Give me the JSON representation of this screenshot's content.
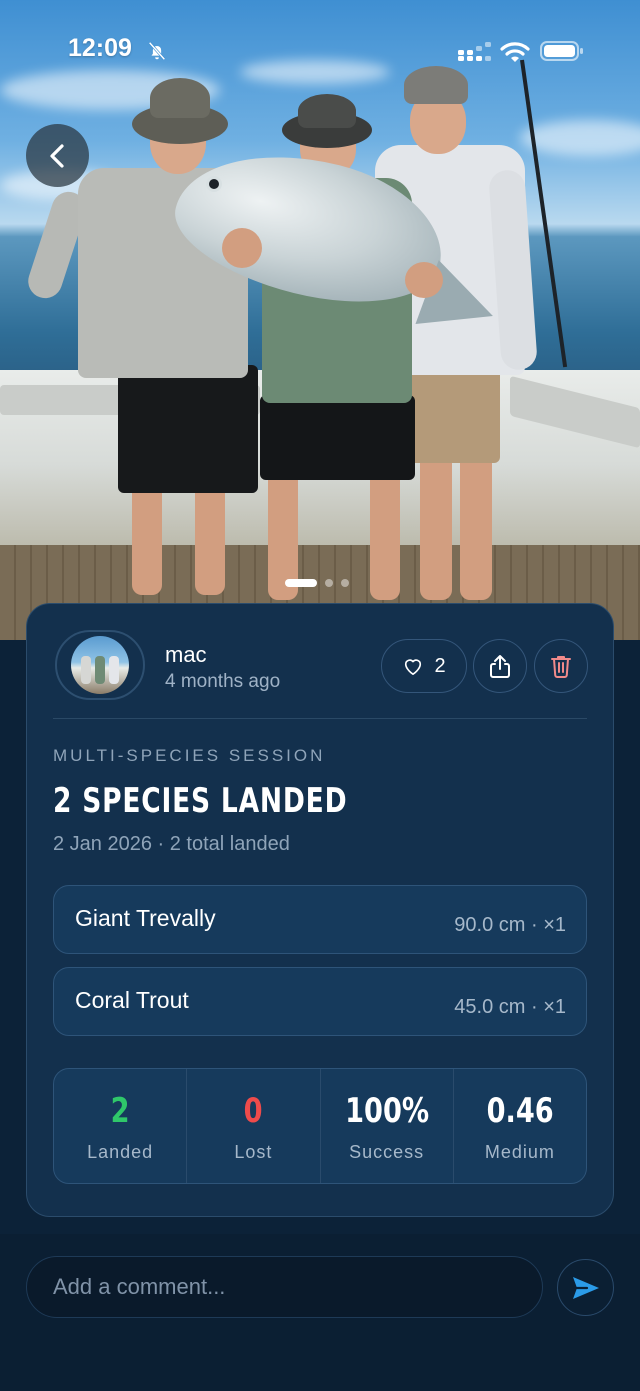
{
  "status_bar": {
    "time": "12:09",
    "icons": [
      "bell-off-icon",
      "signal-icon",
      "wifi-icon",
      "battery-icon"
    ]
  },
  "navigation": {
    "back_icon": "chevron-left-icon"
  },
  "photo_carousel": {
    "total_photos": 3,
    "active_index": 0
  },
  "post": {
    "username": "mac",
    "time_ago": "4 months ago",
    "like_count": "2",
    "actions": [
      "heart-icon",
      "share-icon",
      "trash-icon"
    ],
    "eyebrow": "MULTI-SPECIES SESSION",
    "headline": "2 SPECIES LANDED",
    "subline": "2 Jan 2026 · 2 total landed",
    "species": [
      {
        "name": "Giant Trevally",
        "meta": "90.0 cm · ×1"
      },
      {
        "name": "Coral Trout",
        "meta": "45.0 cm · ×1"
      }
    ],
    "stats": [
      {
        "value": "2",
        "label": "Landed",
        "color": "#2fc76a"
      },
      {
        "value": "0",
        "label": "Lost",
        "color": "#ee4b4b"
      },
      {
        "value": "100%",
        "label": "Success",
        "color": "#ffffff"
      },
      {
        "value": "0.46",
        "label": "Medium",
        "color": "#ffffff"
      }
    ]
  },
  "comment": {
    "placeholder": "Add a comment...",
    "value": ""
  },
  "colors": {
    "background": "#0c2238",
    "card": "#13304d",
    "accent_send": "#2b9be8",
    "delete": "#f08a8a"
  }
}
